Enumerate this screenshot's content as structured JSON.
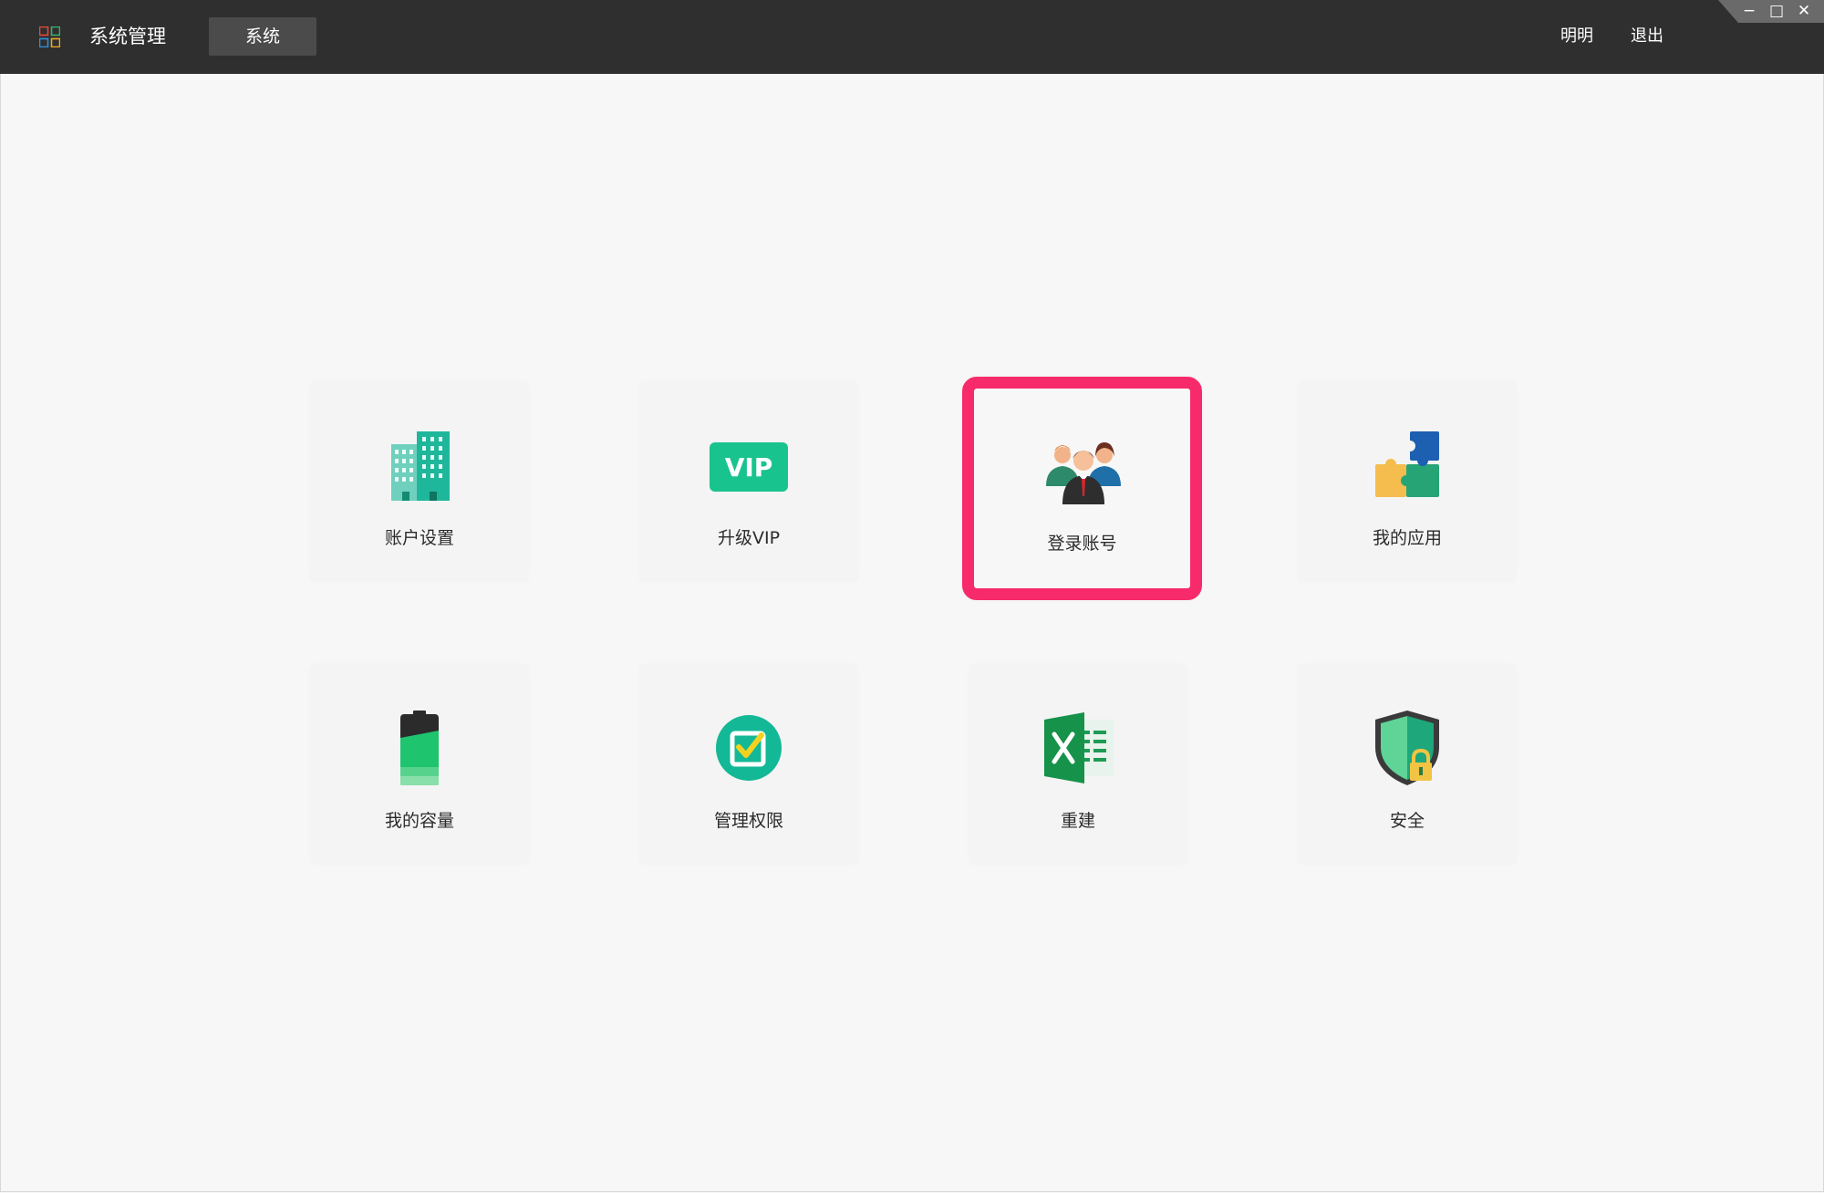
{
  "titlebar": {
    "app_title": "系统管理",
    "tab_label": "系统",
    "user_name": "明明",
    "logout_label": "退出",
    "window_controls": {
      "minimize": "−",
      "maximize": "□",
      "close": "✕"
    },
    "app_icon": "app-grid-icon"
  },
  "colors": {
    "titlebar_bg": "#2f2f2f",
    "tab_active_bg": "#4b4b4b",
    "content_bg": "#f7f7f7",
    "selection_highlight": "#f72a6c",
    "vip_green": "#19c38d"
  },
  "tiles": [
    {
      "label": "账户设置",
      "icon": "building-icon",
      "selected": false
    },
    {
      "label": "升级VIP",
      "icon": "vip-badge-icon",
      "selected": false
    },
    {
      "label": "登录账号",
      "icon": "users-group-icon",
      "selected": true
    },
    {
      "label": "我的应用",
      "icon": "puzzle-icon",
      "selected": false
    },
    {
      "label": "我的容量",
      "icon": "battery-icon",
      "selected": false
    },
    {
      "label": "管理权限",
      "icon": "checkbox-circle-icon",
      "selected": false
    },
    {
      "label": "重建",
      "icon": "excel-icon",
      "selected": false
    },
    {
      "label": "安全",
      "icon": "shield-lock-icon",
      "selected": false
    }
  ],
  "vip_badge_text": "VIP"
}
